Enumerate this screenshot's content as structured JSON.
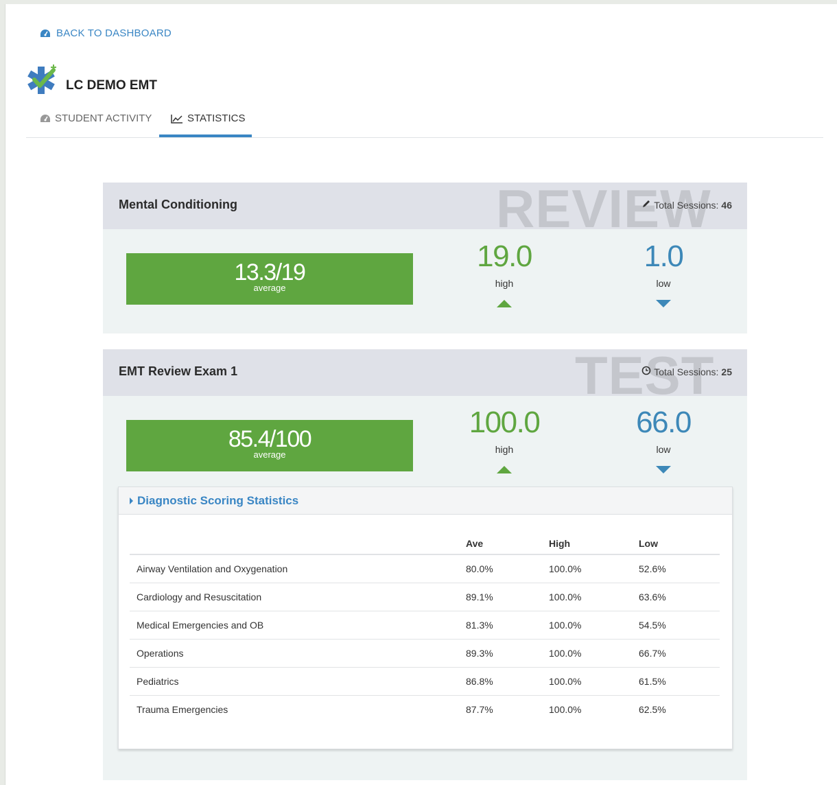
{
  "nav": {
    "back_label": "BACK TO DASHBOARD"
  },
  "brand": {
    "title": "LC DEMO EMT"
  },
  "tabs": [
    {
      "label": "STUDENT ACTIVITY",
      "active": false
    },
    {
      "label": "STATISTICS",
      "active": true
    }
  ],
  "cards": [
    {
      "title": "Mental Conditioning",
      "watermark": "REVIEW",
      "sessions_label": "Total Sessions:",
      "sessions_count": "46",
      "average": "13.3/19",
      "average_label": "average",
      "high": "19.0",
      "high_label": "high",
      "low": "1.0",
      "low_label": "low"
    },
    {
      "title": "EMT Review Exam 1",
      "watermark": "TEST",
      "sessions_label": "Total Sessions:",
      "sessions_count": "25",
      "average": "85.4/100",
      "average_label": "average",
      "high": "100.0",
      "high_label": "high",
      "low": "66.0",
      "low_label": "low"
    }
  ],
  "diagnostic": {
    "title": "Diagnostic Scoring Statistics",
    "columns": [
      "",
      "Ave",
      "High",
      "Low"
    ],
    "rows": [
      [
        "Airway Ventilation and Oxygenation",
        "80.0%",
        "100.0%",
        "52.6%"
      ],
      [
        "Cardiology and Resuscitation",
        "89.1%",
        "100.0%",
        "63.6%"
      ],
      [
        "Medical Emergencies and OB",
        "81.3%",
        "100.0%",
        "54.5%"
      ],
      [
        "Operations",
        "89.3%",
        "100.0%",
        "66.7%"
      ],
      [
        "Pediatrics",
        "86.8%",
        "100.0%",
        "61.5%"
      ],
      [
        "Trauma Emergencies",
        "87.7%",
        "100.0%",
        "62.5%"
      ]
    ]
  },
  "colors": {
    "accent": "#3a86c4",
    "average_green": "#5fa640",
    "low_blue": "#3d88b8",
    "card_header": "#dfe1e8",
    "card_body": "#eef3f3"
  }
}
